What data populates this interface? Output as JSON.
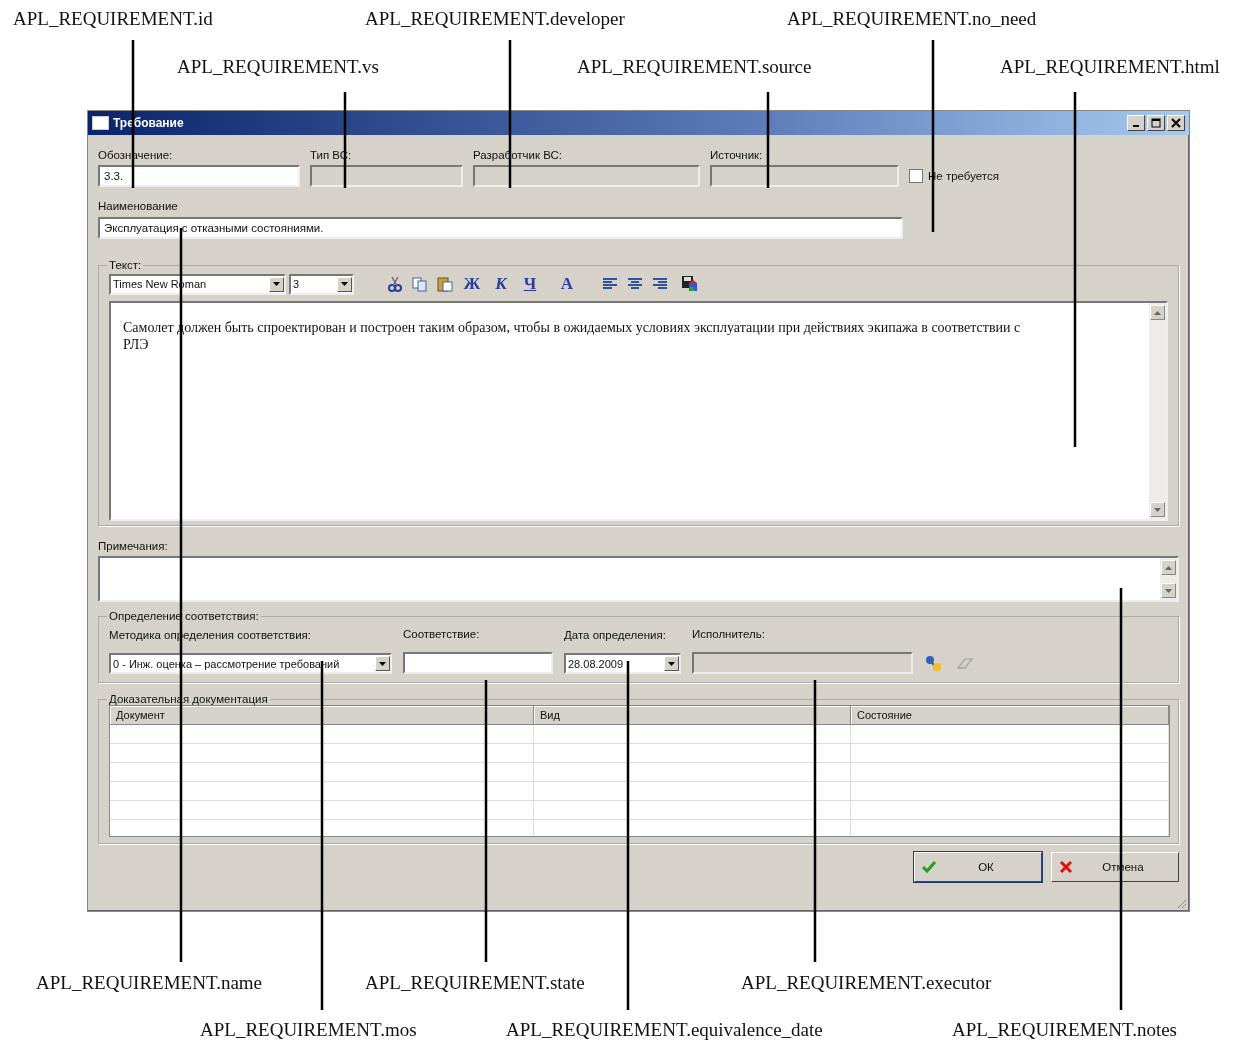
{
  "annotations_top": [
    {
      "label": "APL_REQUIREMENT.id"
    },
    {
      "label": "APL_REQUIREMENT.developer"
    },
    {
      "label": "APL_REQUIREMENT.no_need"
    },
    {
      "label": "APL_REQUIREMENT.vs"
    },
    {
      "label": "APL_REQUIREMENT.source"
    },
    {
      "label": "APL_REQUIREMENT.html"
    }
  ],
  "annotations_bottom": [
    {
      "label": "APL_REQUIREMENT.name"
    },
    {
      "label": "APL_REQUIREMENT.state"
    },
    {
      "label": "APL_REQUIREMENT.executor"
    },
    {
      "label": "APL_REQUIREMENT.mos"
    },
    {
      "label": "APL_REQUIREMENT.equivalence_date"
    },
    {
      "label": "APL_REQUIREMENT.notes"
    }
  ],
  "window": {
    "title": "Требование"
  },
  "top_fields": [
    {
      "label": "Обозначение:",
      "value": "3.3.",
      "disabled": false
    },
    {
      "label": "Тип ВС:",
      "disabled": true
    },
    {
      "label": "Разработчик ВС:",
      "disabled": true
    },
    {
      "label": "Источник:",
      "disabled": true
    }
  ],
  "no_need": {
    "label": "Не требуется",
    "checked": false
  },
  "name_field": {
    "label": "Наименование",
    "value": "Эксплуатация с отказными состояниями."
  },
  "text_group": {
    "legend": "Текст:",
    "font": "Times New Roman",
    "size": "3",
    "format_buttons": [
      {
        "label": "Ж",
        "kind": "bold"
      },
      {
        "label": "К",
        "kind": "italic"
      },
      {
        "label": "Ч",
        "kind": "underline"
      },
      {
        "label": "A",
        "kind": "color"
      }
    ],
    "content": "Самолет должен быть спроектирован и построен таким образом, чтобы в ожидаемых условиях эксплуатации при действиях экипажа в соответствии с РЛЭ"
  },
  "notes": {
    "label": "Примечания:"
  },
  "conformity": {
    "legend": "Определение соответствия:",
    "method": {
      "label": "Методика определения соответствия:",
      "value": "0 - Инж. оценка – рассмотрение требований"
    },
    "state": {
      "label": "Соответствие:"
    },
    "date": {
      "label": "Дата определения:",
      "value": "28.08.2009"
    },
    "executor": {
      "label": "Исполнитель:",
      "disabled": true
    }
  },
  "evidence": {
    "legend": "Доказательная документация",
    "columns": [
      "Документ",
      "Вид",
      "Состояние"
    ]
  },
  "buttons": [
    {
      "label": "ОК",
      "kind": "ok"
    },
    {
      "label": "Отмена",
      "kind": "cancel"
    }
  ]
}
